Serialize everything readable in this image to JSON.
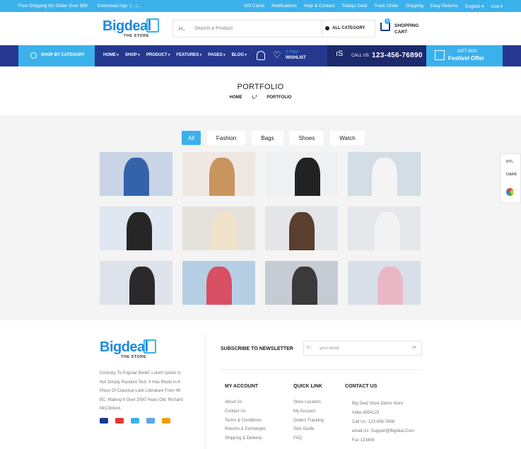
{
  "topbar": {
    "shipping": "Free Shipping On Order Over $99",
    "download": "Download App",
    "download_icons": "i...  i...",
    "links": [
      "Gift Cards",
      "Notifications",
      "Help & Contact",
      "Todays Deal",
      "Track Order",
      "Shipping",
      "Easy Returns"
    ],
    "language": "English",
    "currency": "Usd"
  },
  "header": {
    "logo_big": "Big",
    "logo_deal": "deal",
    "logo_store": "THE STORE",
    "search_placeholder": "Search a Product",
    "search_icon_text": "i<,",
    "category": "ALL CATEGORY",
    "cart_count": "0",
    "cart_label": "SHOPPING CART"
  },
  "nav": {
    "shop_by_category": "SHOP BY CATEGORY",
    "menu": [
      "HOME",
      "SHOP",
      "PRODUCT",
      "FEATURES",
      "PAGES",
      "BLOG"
    ],
    "wishlist_count": "0 ITEM",
    "wishlist_label": "WISHLIST",
    "call_icon_text": "ıS",
    "call_label": "CALL US",
    "phone": "123-456-76890",
    "gift_top": "GIFT BOX",
    "gift_bottom": "Festivel Offer"
  },
  "page": {
    "title": "PORTFOLIO",
    "breadcrumb_home": "HOME",
    "breadcrumb_sep": "i,,*",
    "breadcrumb_current": "PORTFOLIO"
  },
  "portfolio": {
    "tabs": [
      "All",
      "Fashion",
      "Bags",
      "Shoes",
      "Watch"
    ],
    "active_tab": "All",
    "images": [
      {
        "bg": "#c9d5e6",
        "fig": "#3563a9"
      },
      {
        "bg": "#efe8e2",
        "fig": "#c9955f"
      },
      {
        "bg": "#eef0f2",
        "fig": "#222222"
      },
      {
        "bg": "#d2dde4",
        "fig": "#f4f4f4"
      },
      {
        "bg": "#dfe7f1",
        "fig": "#262626"
      },
      {
        "bg": "#e5e2dc",
        "fig": "#efe2c9"
      },
      {
        "bg": "#e3e5e8",
        "fig": "#5a3e2e"
      },
      {
        "bg": "#e6e7ea",
        "fig": "#f2f2f2"
      },
      {
        "bg": "#dde3eb",
        "fig": "#2a2a2a"
      },
      {
        "bg": "#b7cfe4",
        "fig": "#d94f63"
      },
      {
        "bg": "#c5ccd4",
        "fig": "#3a3a3a"
      },
      {
        "bg": "#d8dfe9",
        "fig": "#eab8c4"
      }
    ]
  },
  "side": {
    "rtl": "RTL",
    "dark": "DARK"
  },
  "footer": {
    "description": "Contrary To Popular Belief, Lorem Ipsum Is Not Simply Random Text. It Has Roots In A Piece Of Classical Latin Literature From 45 BC, Making It Over 2000 Years Old. Richard McClintock.",
    "newsletter_title": "SUBSCRIBE TO NEWSLETTER",
    "email_placeholder": "your email",
    "email_icon_text": "i<,'",
    "submit_icon_text": "i>",
    "payment_colors": [
      "#1a3b8c",
      "#e53935",
      "#3bb1ec",
      "#5aa9e6",
      "#f39c12"
    ],
    "my_account": {
      "title": "MY ACCOUNT",
      "links": [
        "About Us",
        "Contact Us",
        "Terms & Conditions",
        "Returns & Exchanges",
        "Shipping & Delivery"
      ]
    },
    "quick_link": {
      "title": "QUICK LINK",
      "links": [
        "Store Location",
        "My Account",
        "Orders Tracking",
        "Size Guide",
        "FAQ"
      ]
    },
    "contact": {
      "title": "CONTACT US",
      "lines": [
        "Big Deal Store Demo Store",
        "India-3654123",
        "Call Us: 123-456-7898",
        "email Us: Support@Bigdeal.Com",
        "Fax 123456"
      ]
    }
  }
}
